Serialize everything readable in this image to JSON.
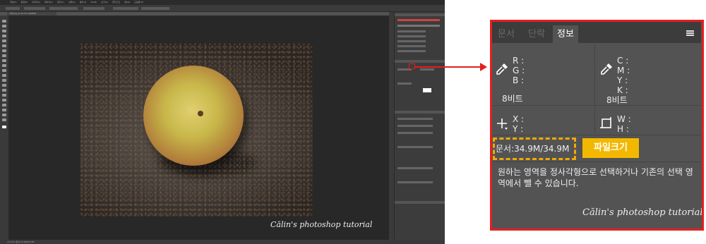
{
  "photoshop": {
    "menu": [
      "파일(F)",
      "편집(E)",
      "이미지(I)",
      "레이어(L)",
      "문자(Y)",
      "선택(S)",
      "필터(T)",
      "3D(D)",
      "보기(V)",
      "플러그인",
      "창(W)",
      "도움말(H)"
    ],
    "doc_tab": "사과.jpg @ 33.3% (RGB/8)",
    "status": "33.33%   문서:34.9M/34.9M",
    "signature": "Călin's photoshop tutorial"
  },
  "info_panel": {
    "tabs": [
      {
        "label": "문서"
      },
      {
        "label": "단락"
      },
      {
        "label": "정보"
      }
    ],
    "rgb_labels": [
      "R :",
      "G :",
      "B :"
    ],
    "cmyk_labels": [
      "C :",
      "M :",
      "Y :",
      "K :"
    ],
    "bit_left": "8비트",
    "bit_right": "8비트",
    "xy_labels": [
      "X :",
      "Y :"
    ],
    "wh_labels": [
      "W :",
      "H :"
    ],
    "doc_size": "문서:34.9M/34.9M",
    "file_size_badge": "파일크기",
    "description": "원하는 영역을 정사각형으로 선택하거나 기존의 선택 영역에서 뺄 수 있습니다.",
    "signature": "Călin's photoshop tutorial"
  },
  "colors": {
    "highlight_red": "#e41e1e",
    "highlight_yellow": "#f2b800",
    "panel_bg": "#535353"
  },
  "icons": {
    "eyedropper": "eyedropper-icon",
    "crosshair": "crosshair-icon",
    "selection_size": "selection-size-icon",
    "panel_menu": "panel-menu-icon"
  }
}
